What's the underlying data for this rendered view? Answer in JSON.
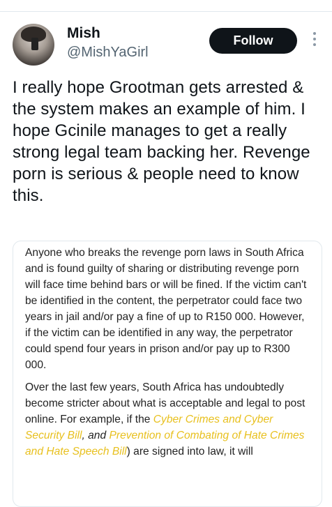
{
  "user": {
    "name": "Mish",
    "handle": "@MishYaGirl",
    "follow_label": "Follow"
  },
  "icons": {
    "more": "more-vertical-icon",
    "avatar": "profile-photo"
  },
  "tweet": {
    "text": "I really hope Grootman gets arrested & the system makes an example of him. I hope Gcinile manages to get a really strong legal team backing her. Revenge porn is serious & people need to know this."
  },
  "article": {
    "paragraph1": "Anyone who breaks the revenge porn laws in South Africa and is found guilty of sharing or distributing revenge porn will face time behind bars or will be fined. If the victim can't be identified in the content, the perpetrator could face two years in jail and/or pay a fine of up to R150 000. However, if the victim can be identified in any way, the perpetrator could spend four years in prison and/or pay up to R300 000.",
    "paragraph2_intro": "Over the last few years, South Africa has undoubtedly become stricter about what is acceptable and legal to post online. For example, if the ",
    "link1": "Cyber Crimes and Cyber Security Bill",
    "sep": ", and ",
    "link2": "Prevention of Combating of Hate Crimes and Hate Speech Bill",
    "paragraph2_end": ") are signed into law, it will"
  },
  "colors": {
    "follow_bg": "#0f1419",
    "handle": "#536471",
    "highlight": "#e8c01e",
    "border": "#e1e8ed"
  }
}
